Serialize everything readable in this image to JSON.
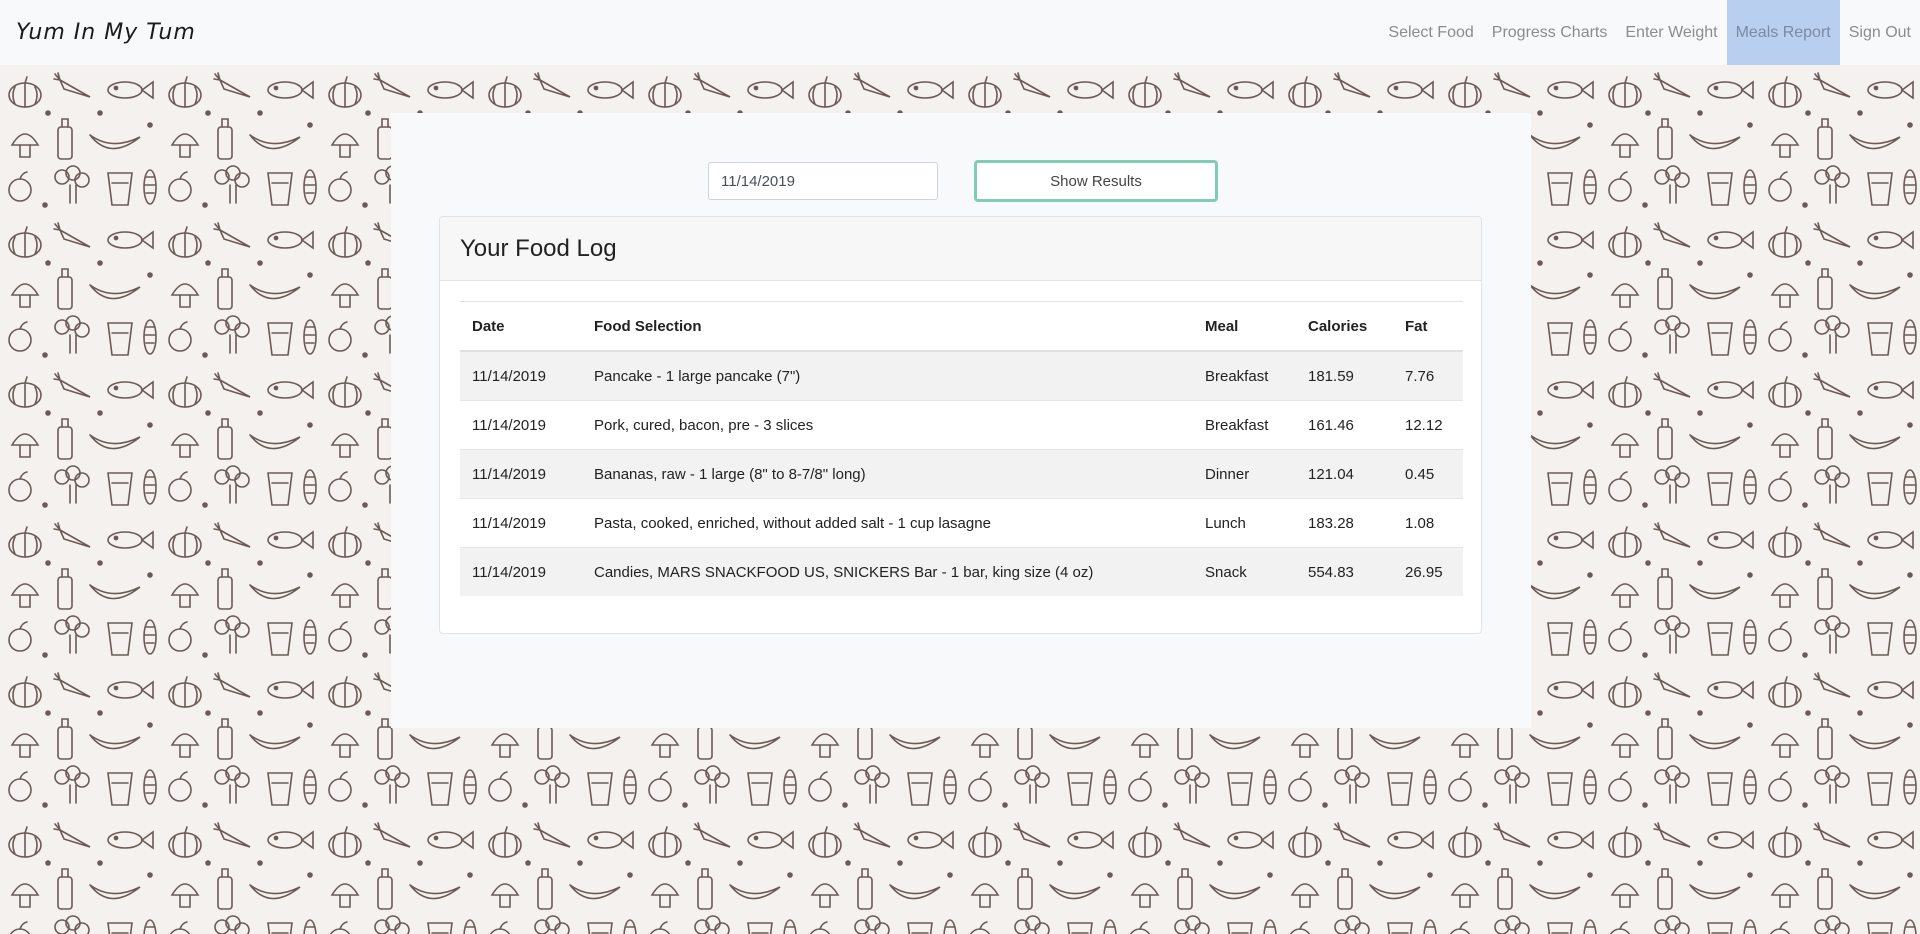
{
  "app": {
    "brand": "Yum In My Tum"
  },
  "nav": {
    "items": [
      {
        "label": "Select Food",
        "active": false
      },
      {
        "label": "Progress Charts",
        "active": false
      },
      {
        "label": "Enter Weight",
        "active": false
      },
      {
        "label": "Meals Report",
        "active": true
      },
      {
        "label": "Sign Out",
        "active": false
      }
    ]
  },
  "controls": {
    "date_value": "11/14/2019",
    "show_button": "Show Results"
  },
  "food_log": {
    "title": "Your Food Log",
    "columns": [
      "Date",
      "Food Selection",
      "Meal",
      "Calories",
      "Fat"
    ],
    "rows": [
      [
        "11/14/2019",
        "Pancake - 1 large pancake (7\")",
        "Breakfast",
        "181.59",
        "7.76"
      ],
      [
        "11/14/2019",
        "Pork, cured, bacon, pre - 3 slices",
        "Breakfast",
        "161.46",
        "12.12"
      ],
      [
        "11/14/2019",
        "Bananas, raw - 1 large (8\" to 8-7/8\" long)",
        "Dinner",
        "121.04",
        "0.45"
      ],
      [
        "11/14/2019",
        "Pasta, cooked, enriched, without added salt - 1 cup lasagne",
        "Lunch",
        "183.28",
        "1.08"
      ],
      [
        "11/14/2019",
        "Candies, MARS SNACKFOOD US, SNICKERS Bar - 1 bar, king size (4 oz)",
        "Snack",
        "554.83",
        "26.95"
      ]
    ]
  },
  "colors": {
    "accent_border": "#7fcdb5",
    "active_nav": "#b8cff0",
    "doodle_ink": "#6b5a55"
  }
}
